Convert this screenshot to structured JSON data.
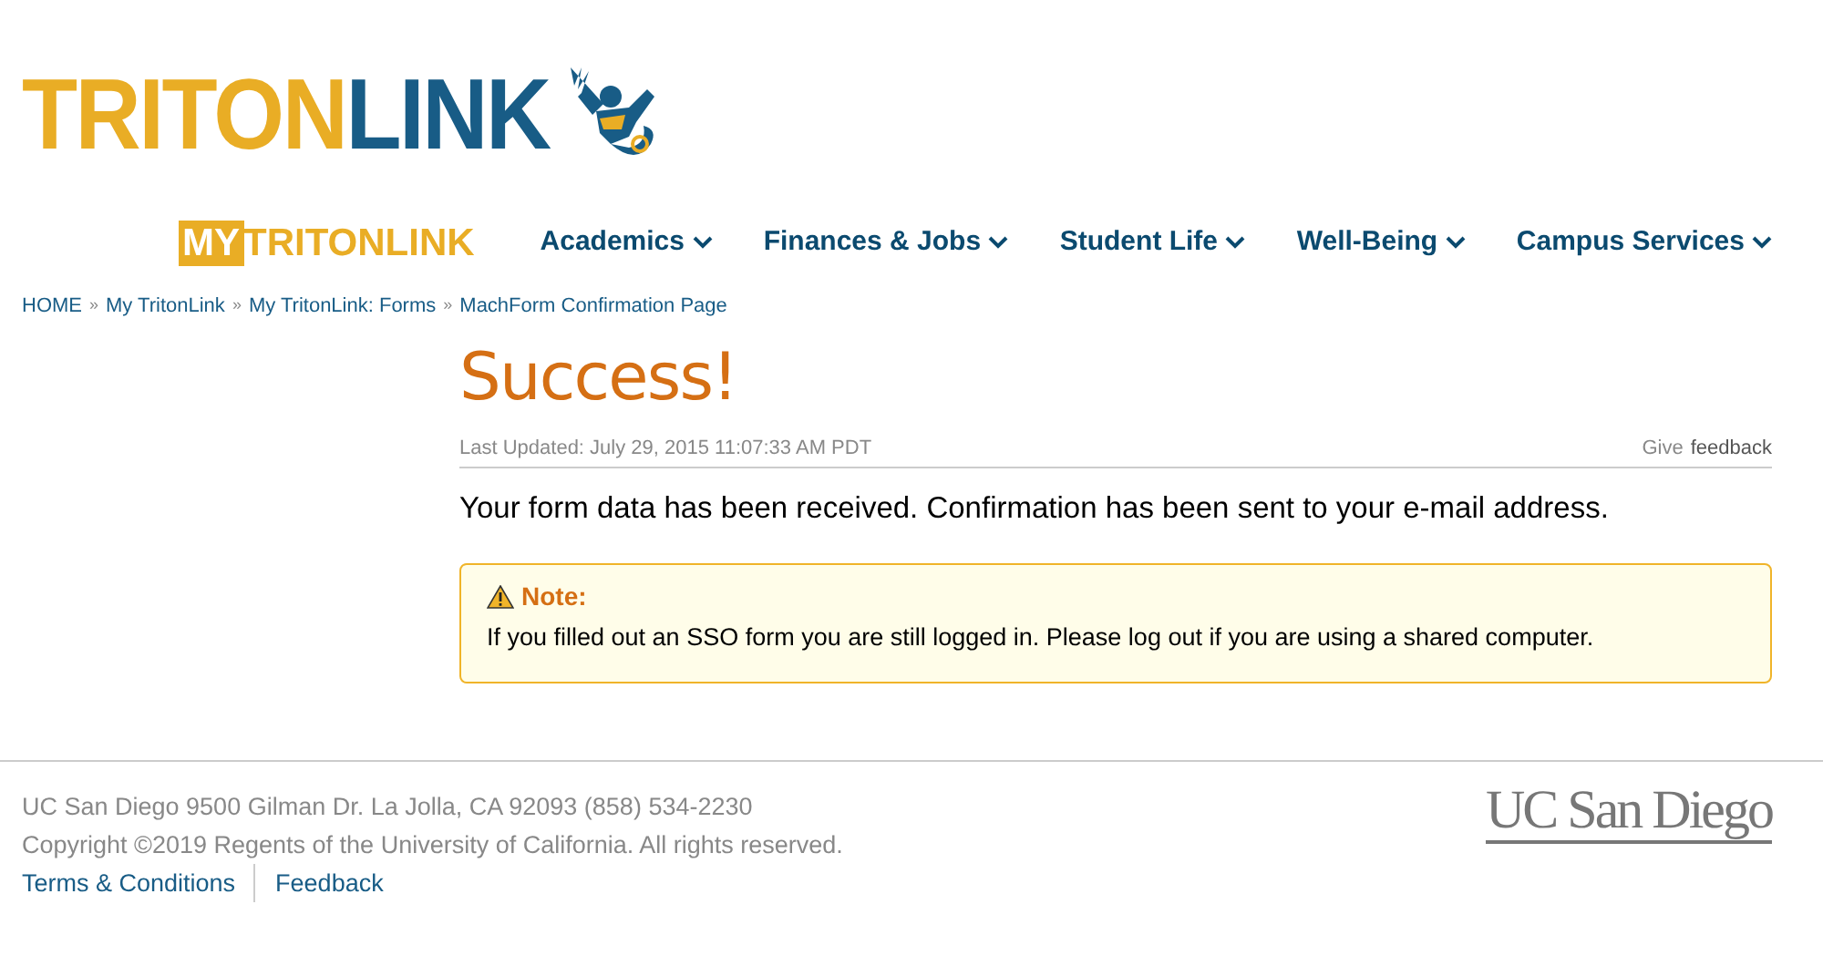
{
  "logo": {
    "part_1": "TRITON",
    "part_2": "LINK"
  },
  "nav": {
    "brand": {
      "part_1": "MY",
      "part_2": "TRITONLINK"
    },
    "items": [
      {
        "label": "Academics"
      },
      {
        "label": "Finances & Jobs"
      },
      {
        "label": "Student Life"
      },
      {
        "label": "Well-Being"
      },
      {
        "label": "Campus Services"
      }
    ]
  },
  "breadcrumb": [
    {
      "label": "HOME"
    },
    {
      "label": "My TritonLink"
    },
    {
      "label": "My TritonLink: Forms"
    },
    {
      "label": "MachForm Confirmation Page"
    }
  ],
  "breadcrumb_separator": "»",
  "page": {
    "title": "Success!",
    "last_updated": "Last Updated: July 29, 2015 11:07:33 AM PDT",
    "give": "Give",
    "feedback_link": "feedback",
    "message": "Your form data has been received. Confirmation has been sent to your e-mail address.",
    "note": {
      "title": "Note:",
      "text": "If you filled out an SSO form you are still logged in. Please log out if you are using a shared computer."
    }
  },
  "footer": {
    "address": "UC San Diego 9500 Gilman Dr. La Jolla, CA 92093 (858) 534-2230",
    "copyright": "Copyright ©2019 Regents of the University of California. All rights reserved.",
    "links": [
      {
        "label": "Terms & Conditions"
      },
      {
        "label": "Feedback"
      }
    ],
    "logo": "UC San Diego"
  }
}
